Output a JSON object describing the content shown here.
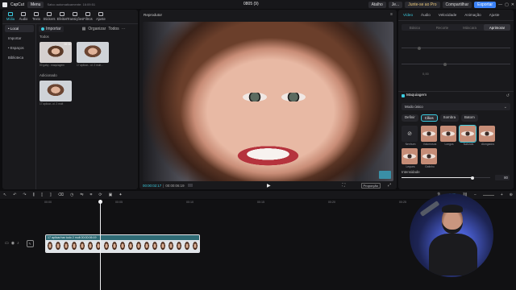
{
  "app": {
    "name": "CapCut",
    "menu_label": "Menu",
    "project_note": "Salvo automaticamente: 16:09:51",
    "project_title": "0805 (9)"
  },
  "topbar": {
    "shortcut_label": "Atalho",
    "user_label": "Je...",
    "pro_label": "Junte-se ao Pro",
    "share_label": "Compartilhar",
    "export_label": "Exportar"
  },
  "media_tabs": [
    {
      "label": "Mídia",
      "icon": "media-icon"
    },
    {
      "label": "Áudio",
      "icon": "audio-icon"
    },
    {
      "label": "Texto",
      "icon": "text-icon"
    },
    {
      "label": "Stickers",
      "icon": "sticker-icon"
    },
    {
      "label": "Efeitos",
      "icon": "effects-icon"
    },
    {
      "label": "Transições",
      "icon": "transitions-icon"
    },
    {
      "label": "Filtros",
      "icon": "filters-icon"
    },
    {
      "label": "Ajuste",
      "icon": "adjust-icon"
    }
  ],
  "sidebar": {
    "items": [
      "• Local",
      "Importar",
      "• Espaços",
      "Biblioteca"
    ]
  },
  "media_toolbar": {
    "import_label": "Importar",
    "sort_label": "Organizar",
    "filter_label": "Todos"
  },
  "media": {
    "all_label": "Todos",
    "added_label": "Adicionado",
    "items": [
      {
        "name": "00 gaby - maquiagem",
        "duration": "00:10"
      },
      {
        "name": "17 aplicar... ol. 2 mult...",
        "duration": ""
      },
      {
        "name": "17 aplicar...ol. 2 mult",
        "duration": ""
      }
    ]
  },
  "player": {
    "label": "Reprodutor",
    "time_current": "00:00:02:17",
    "time_total": "00:00:06:19",
    "ratio_label": "Proporção"
  },
  "right_panel": {
    "tabs": [
      "Vídeo",
      "Áudio",
      "Velocidade",
      "Animação",
      "Ajuste"
    ],
    "segments": [
      "Básico",
      "Recorte",
      "Máscara",
      "Aprimorar"
    ],
    "value_a": "0,00",
    "section_title": "Maquiagem",
    "mode_label": "Modo único",
    "chips": [
      "Definir",
      "Cílios",
      "Sombra",
      "Batom"
    ],
    "looks": [
      "Nenhum",
      "Volumosos",
      "Longos",
      "Naturais",
      "Alongados",
      "Leques",
      "Gatinho"
    ],
    "intensity_label": "Intensidade",
    "intensity_value": "80"
  },
  "timeline": {
    "ruler": [
      "00:00",
      "00:05",
      "00:10",
      "00:15",
      "00:20",
      "00:25"
    ],
    "clip_label": "17 aplicar/nar todo 2 mult 00:00:06:19",
    "playhead_fraction": 0.125
  },
  "colors": {
    "accent": "#3ccce0",
    "export": "#3b82f6"
  }
}
